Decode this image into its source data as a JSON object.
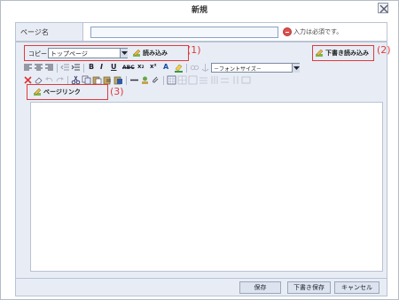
{
  "dialog": {
    "title": "新規",
    "close_icon": "close-icon"
  },
  "name_row": {
    "label": "ページ名",
    "input_value": "",
    "required_icon": "minus-circle-icon",
    "required_text": "入力は必須です。"
  },
  "editor": {
    "copy_label": "コピー",
    "page_select_value": "トップページ",
    "load_label": "読み込み",
    "draft_load_label": "下書き読み込み",
    "page_link_label": "ページリンク",
    "font_size_select_value": "－フォントサイズ－",
    "toolbar_text_buttons": {
      "bold": "B",
      "italic": "I",
      "underline": "U",
      "strike": "ABC",
      "subscript": "x₂",
      "superscript": "x²",
      "text_color": "A"
    },
    "content": ""
  },
  "annotations": [
    "(1)",
    "(2)",
    "(3)"
  ],
  "footer": {
    "save_label": "保存",
    "draft_save_label": "下書き保存",
    "cancel_label": "キャンセル"
  },
  "colors": {
    "annotation_red": "#e03a3a",
    "panel_bg": "#e8edf5",
    "border": "#b9c3d3"
  }
}
